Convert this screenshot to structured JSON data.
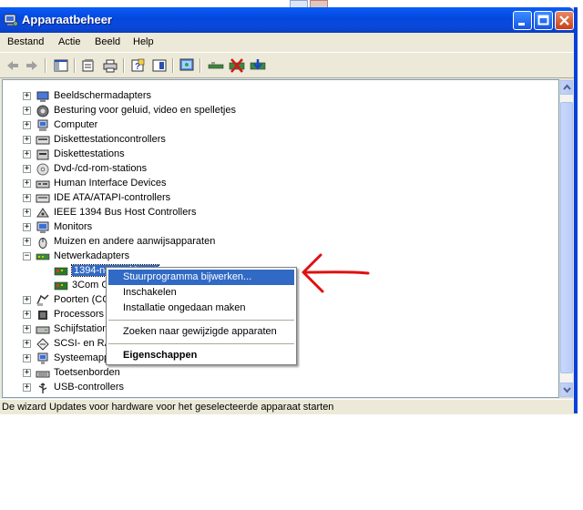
{
  "window": {
    "title": "Apparaatbeheer",
    "title_icon": "computer-management-icon",
    "accent": "#0a5ef8"
  },
  "menubar": [
    "Bestand",
    "Actie",
    "Beeld",
    "Help"
  ],
  "toolbar": {
    "buttons": [
      "back-arrow-icon",
      "forward-arrow-icon",
      "show-hide-tree-icon",
      "properties-icon",
      "print-icon",
      "help-icon",
      "view-icon",
      "scan-hardware-icon",
      "update-driver-icon",
      "uninstall-icon",
      "enable-device-icon"
    ]
  },
  "tree": {
    "items": [
      {
        "label": "Beeldschermadapters",
        "icon": "display-adapter-icon",
        "expander": "+"
      },
      {
        "label": "Besturing voor geluid, video en spelletjes",
        "icon": "sound-icon",
        "expander": "+"
      },
      {
        "label": "Computer",
        "icon": "computer-icon",
        "expander": "+"
      },
      {
        "label": "Diskettestationcontrollers",
        "icon": "floppy-controller-icon",
        "expander": "+"
      },
      {
        "label": "Diskettestations",
        "icon": "floppy-drive-icon",
        "expander": "+"
      },
      {
        "label": "Dvd-/cd-rom-stations",
        "icon": "cdrom-icon",
        "expander": "+"
      },
      {
        "label": "Human Interface Devices",
        "icon": "hid-icon",
        "expander": "+"
      },
      {
        "label": "IDE ATA/ATAPI-controllers",
        "icon": "ide-controller-icon",
        "expander": "+"
      },
      {
        "label": "IEEE 1394 Bus Host Controllers",
        "icon": "ieee1394-icon",
        "expander": "+"
      },
      {
        "label": "Monitors",
        "icon": "monitor-icon",
        "expander": "+"
      },
      {
        "label": "Muizen en andere aanwijsapparaten",
        "icon": "mouse-icon",
        "expander": "+"
      },
      {
        "label": "Netwerkadapters",
        "icon": "network-adapter-icon",
        "expander": "−"
      },
      {
        "label": "1394-netwerkkaart",
        "icon": "network-card-icon",
        "child": true,
        "selected": true
      },
      {
        "label": "3Com G",
        "icon": "network-card-icon",
        "child": true
      },
      {
        "label": "Poorten (CC",
        "icon": "port-icon",
        "expander": "+"
      },
      {
        "label": "Processors",
        "icon": "processor-icon",
        "expander": "+"
      },
      {
        "label": "Schijfstation",
        "icon": "disk-drive-icon",
        "expander": "+"
      },
      {
        "label": "SCSI- en RA",
        "icon": "scsi-icon",
        "expander": "+"
      },
      {
        "label": "Systeemapp",
        "icon": "system-device-icon",
        "expander": "+"
      },
      {
        "label": "Toetsenborden",
        "icon": "keyboard-icon",
        "expander": "+"
      },
      {
        "label": "USB-controllers",
        "icon": "usb-icon",
        "expander": "+"
      }
    ]
  },
  "context_menu": {
    "items": [
      {
        "label": "Stuurprogramma bijwerken...",
        "highlighted": true
      },
      {
        "label": "Inschakelen"
      },
      {
        "label": "Installatie ongedaan maken"
      },
      {
        "separator": true
      },
      {
        "label": "Zoeken naar gewijzigde apparaten"
      },
      {
        "separator": true
      },
      {
        "label": "Eigenschappen",
        "bold": true
      }
    ]
  },
  "annotation": {
    "arrow_color": "#e01010"
  },
  "statusbar": {
    "text": "De wizard Updates voor hardware voor het geselecteerde apparaat starten"
  }
}
